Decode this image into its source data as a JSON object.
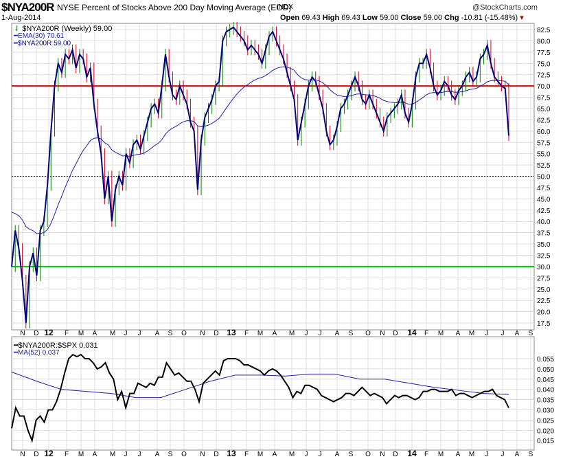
{
  "header": {
    "symbol": "$NYA200R",
    "title": "NYSE Percent of Stocks Above 200 Day Moving Average (EOD)",
    "exchange": "INDX",
    "date": "1-Aug-2014",
    "watermark": "@StockCharts.com",
    "open_label": "Open",
    "open": "69.43",
    "high_label": "High",
    "high": "69.43",
    "low_label": "Low",
    "low": "59.00",
    "close_label": "Close",
    "close": "59.00",
    "chg_label": "Chg",
    "chg": "-10.81 (-15.48%)"
  },
  "colors": {
    "price": "#000080",
    "ema": "#2020b0",
    "up": "#008000",
    "down": "#d00020",
    "ref70": "#e00000",
    "ref30": "#00cc00",
    "ratio": "#000000",
    "ma": "#2020a0"
  },
  "chart_data": [
    {
      "type": "line",
      "title": "$NYA200R (Weekly) 59.00",
      "legend": [
        "$NYA200R (Weekly) 59.00",
        "EMA(30) 70.61",
        "$NYA200R 59.00"
      ],
      "legend_placement": "top-left",
      "ylim": [
        15,
        84
      ],
      "yticks": [
        "82.5",
        "80.0",
        "77.5",
        "75.0",
        "72.5",
        "70.0",
        "67.5",
        "65.0",
        "62.5",
        "60.0",
        "57.5",
        "55.0",
        "52.5",
        "50.0",
        "47.5",
        "45.0",
        "42.5",
        "40.0",
        "37.5",
        "35.0",
        "32.5",
        "30.0",
        "27.5",
        "25.0",
        "22.5",
        "20.0",
        "17.5"
      ],
      "reference_lines": [
        70,
        50,
        30
      ],
      "closes": [
        30,
        38,
        34,
        27,
        17.5,
        30,
        33,
        28,
        38,
        40,
        48,
        60,
        70,
        75,
        73,
        77,
        76,
        78,
        74,
        77,
        76,
        72,
        74,
        66,
        60,
        55,
        45,
        50,
        40,
        47,
        50,
        48,
        55,
        53,
        57,
        58,
        56,
        59,
        62,
        65,
        66,
        64,
        70,
        77,
        72,
        68,
        67,
        70,
        68,
        66,
        62,
        60,
        47,
        58,
        63,
        65,
        67,
        70,
        71,
        80,
        82,
        82.5,
        83,
        82,
        81,
        80,
        78,
        79,
        78,
        77,
        75,
        78,
        81,
        82,
        80,
        78,
        76,
        73,
        70,
        67,
        58,
        62,
        66,
        70,
        72,
        71,
        68,
        65,
        60,
        57,
        58,
        61,
        65,
        66,
        68,
        70,
        72,
        70,
        67,
        66,
        68,
        66,
        64,
        62,
        60,
        63,
        64,
        65,
        66,
        68,
        64,
        62,
        66,
        72,
        75,
        75,
        77,
        74,
        70,
        68,
        69,
        71,
        70,
        68,
        67,
        69,
        70,
        72,
        73,
        71,
        72,
        76,
        77,
        79,
        75,
        72,
        71,
        70,
        69.43,
        59
      ]
    },
    {
      "type": "line",
      "legend": [
        "$NYA200R:$SPX 0.031",
        "MA(52) 0.037"
      ],
      "legend_placement": "top-left",
      "ylim": [
        0.0125,
        0.058
      ],
      "yticks": [
        "0.055",
        "0.050",
        "0.045",
        "0.040",
        "0.035",
        "0.030",
        "0.025",
        "0.020",
        "0.015"
      ],
      "ratio": [
        0.021,
        0.031,
        0.027,
        0.027,
        0.02,
        0.015,
        0.025,
        0.027,
        0.024,
        0.03,
        0.03,
        0.034,
        0.04,
        0.048,
        0.055,
        0.057,
        0.056,
        0.057,
        0.055,
        0.055,
        0.053,
        0.05,
        0.051,
        0.053,
        0.048,
        0.045,
        0.035,
        0.039,
        0.031,
        0.038,
        0.038,
        0.043,
        0.042,
        0.041,
        0.043,
        0.042,
        0.046,
        0.046,
        0.053,
        0.05,
        0.047,
        0.048,
        0.046,
        0.044,
        0.044,
        0.04,
        0.034,
        0.043,
        0.045,
        0.047,
        0.049,
        0.047,
        0.054,
        0.055,
        0.055,
        0.055,
        0.054,
        0.052,
        0.052,
        0.051,
        0.05,
        0.049,
        0.047,
        0.049,
        0.05,
        0.049,
        0.047,
        0.044,
        0.041,
        0.036,
        0.039,
        0.038,
        0.042,
        0.042,
        0.041,
        0.04,
        0.037,
        0.036,
        0.035,
        0.034,
        0.035,
        0.036,
        0.038,
        0.038,
        0.037,
        0.039,
        0.041,
        0.039,
        0.037,
        0.038,
        0.037,
        0.036,
        0.033,
        0.035,
        0.037,
        0.036,
        0.037,
        0.037,
        0.036,
        0.035,
        0.036,
        0.039,
        0.039,
        0.04,
        0.04,
        0.039,
        0.039,
        0.039,
        0.04,
        0.037,
        0.038,
        0.038,
        0.037,
        0.036,
        0.037,
        0.038,
        0.039,
        0.039,
        0.04,
        0.037,
        0.036,
        0.035,
        0.031
      ],
      "ma52": [
        0.0485,
        0.044,
        0.04,
        0.039,
        0.038,
        0.036,
        0.036,
        0.04,
        0.044,
        0.047,
        0.047,
        0.0465,
        0.0475,
        0.0475,
        0.045,
        0.045,
        0.043,
        0.041,
        0.0395,
        0.038,
        0.0375
      ]
    }
  ],
  "months": [
    "N",
    "D",
    "12",
    "F",
    "M",
    "A",
    "M",
    "J",
    "J",
    "A",
    "S",
    "O",
    "N",
    "D",
    "13",
    "F",
    "M",
    "A",
    "M",
    "J",
    "J",
    "A",
    "S",
    "O",
    "N",
    "D",
    "14",
    "F",
    "M",
    "A",
    "M",
    "J",
    "J",
    "A",
    "S"
  ]
}
